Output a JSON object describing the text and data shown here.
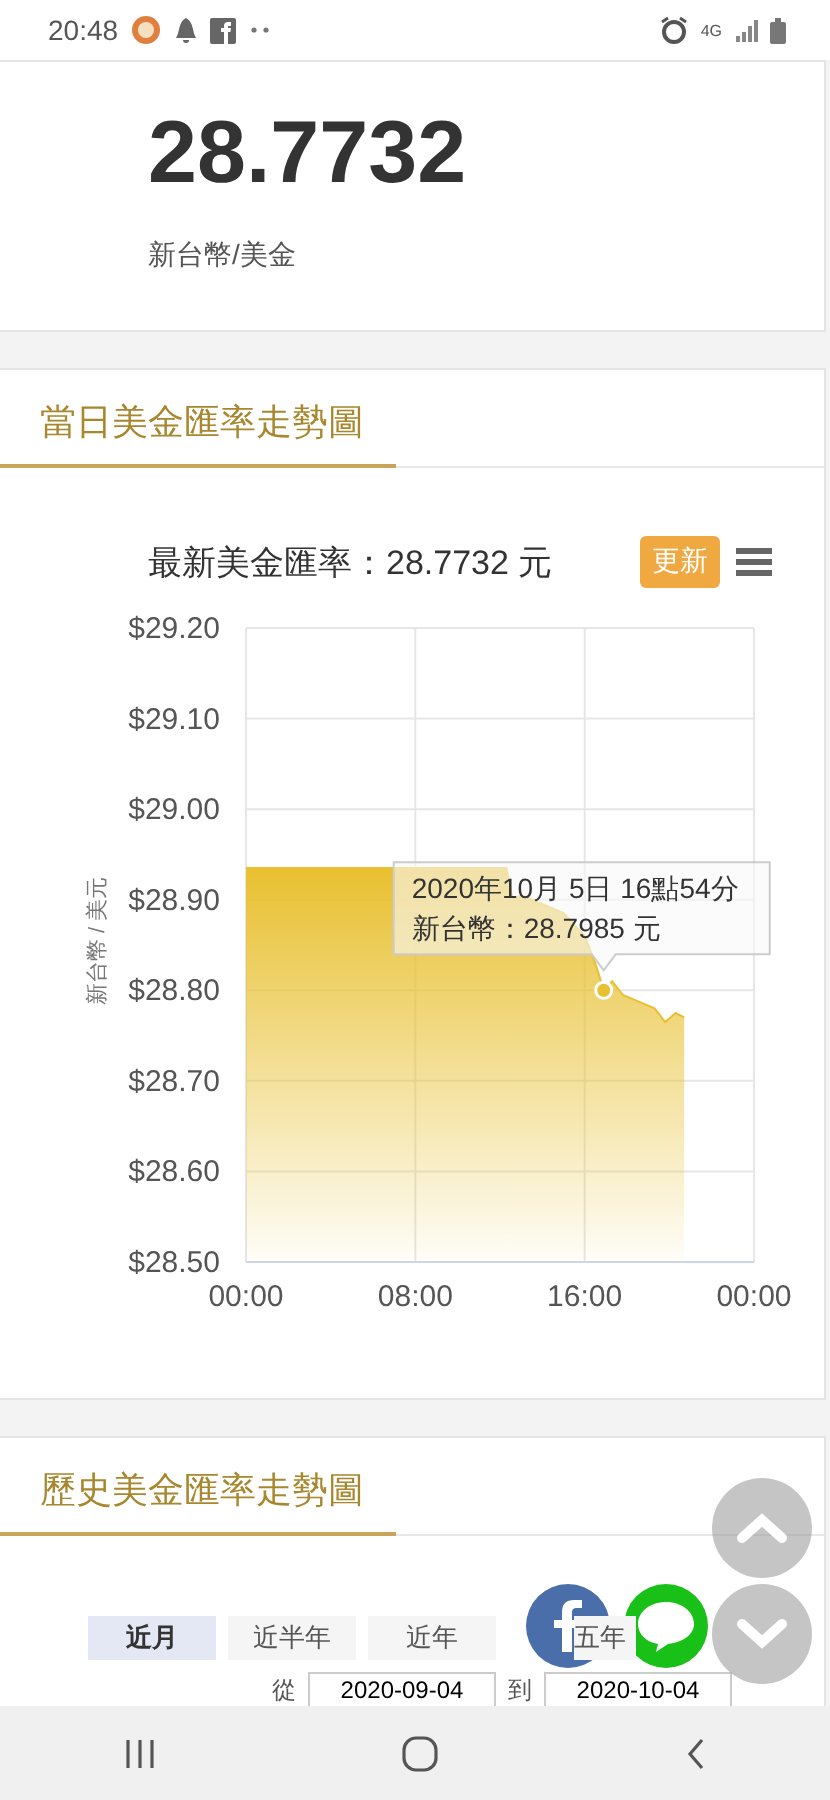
{
  "status_bar": {
    "time": "20:48",
    "network": "4G"
  },
  "rate_card": {
    "value": "28.7732",
    "unit": "新台幣/美金"
  },
  "intraday": {
    "heading": "當日美金匯率走勢圖",
    "refresh_button": "更新",
    "chart_data": {
      "type": "area",
      "title": "最新美金匯率：28.7732 元",
      "ylabel": "新台幣 / 美元",
      "x": [
        0,
        2,
        4,
        6,
        8,
        10,
        12,
        12.3,
        12.6,
        13,
        14,
        15,
        16,
        16.5,
        16.9,
        17.3,
        17.8,
        18.3,
        18.8,
        19.3,
        19.8,
        20.3,
        20.7
      ],
      "series": [
        {
          "color": "#e8c030",
          "values": [
            28.935,
            28.935,
            28.935,
            28.935,
            28.935,
            28.935,
            28.935,
            28.935,
            28.9,
            28.905,
            28.895,
            28.885,
            28.86,
            28.83,
            28.8,
            28.81,
            28.795,
            28.79,
            28.785,
            28.78,
            28.765,
            28.775,
            28.77
          ]
        }
      ],
      "xlim": [
        0,
        24
      ],
      "ylim": [
        28.5,
        29.2
      ],
      "xticks": [
        {
          "value": 0,
          "label": "00:00"
        },
        {
          "value": 8,
          "label": "08:00"
        },
        {
          "value": 16,
          "label": "16:00"
        },
        {
          "value": 24,
          "label": "00:00"
        }
      ],
      "yticks": [
        {
          "value": 29.2,
          "label": "$29.20"
        },
        {
          "value": 29.1,
          "label": "$29.10"
        },
        {
          "value": 29.0,
          "label": "$29.00"
        },
        {
          "value": 28.9,
          "label": "$28.90"
        },
        {
          "value": 28.8,
          "label": "$28.80"
        },
        {
          "value": 28.7,
          "label": "$28.70"
        },
        {
          "value": 28.6,
          "label": "$28.60"
        },
        {
          "value": 28.5,
          "label": "$28.50"
        }
      ],
      "grid": true,
      "annotations": [
        {
          "text": [
            "2020年10月 5日 16點54分",
            "新台幣：28.7985 元"
          ]
        }
      ]
    }
  },
  "history": {
    "heading": "歷史美金匯率走勢圖",
    "tabs": [
      {
        "label": "近月",
        "selected": true
      },
      {
        "label": "近半年",
        "selected": false
      },
      {
        "label": "近年",
        "selected": false
      },
      {
        "label": "五年",
        "selected": false
      }
    ],
    "from_label": "從",
    "from_date": "2020-09-04",
    "to_label": "到",
    "to_date": "2020-10-04"
  }
}
